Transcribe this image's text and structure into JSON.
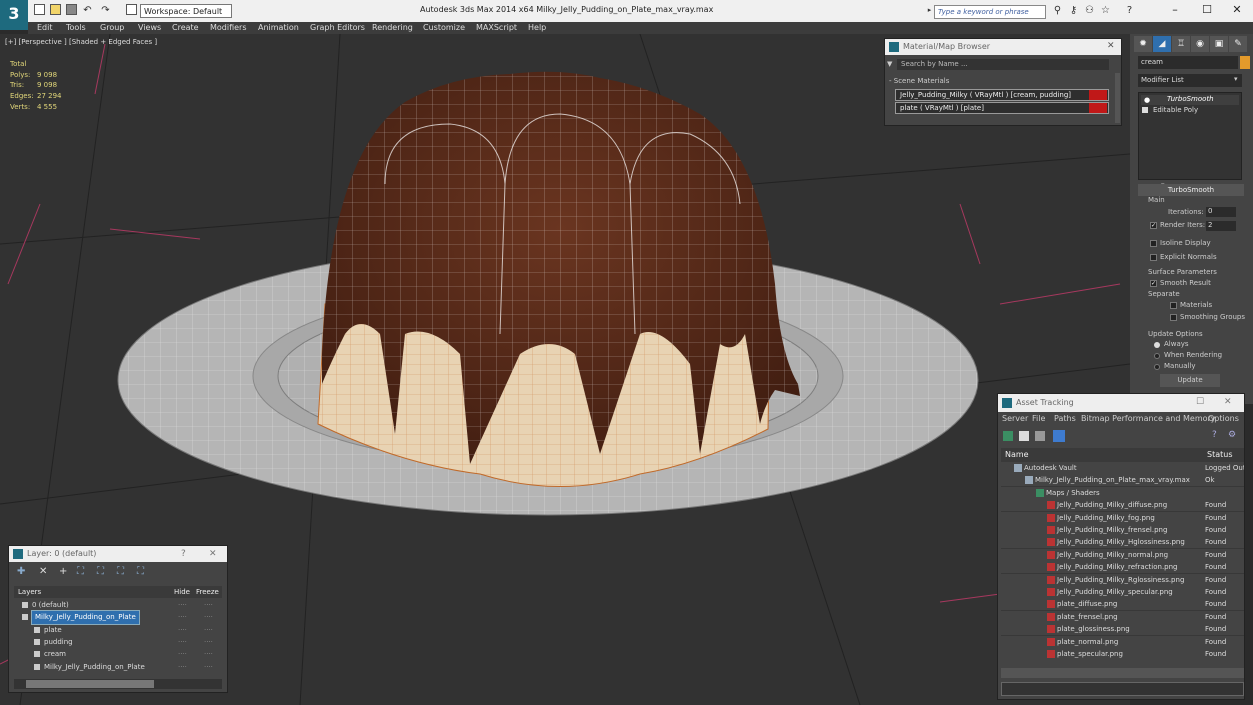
{
  "titlebar": {
    "logo": "3",
    "workspace_label": "Workspace: Default",
    "app_title": "Autodesk 3ds Max  2014 x64      Milky_Jelly_Pudding_on_Plate_max_vray.max",
    "search_placeholder": "Type a keyword or phrase",
    "minimize": "–",
    "maximize": "☐",
    "close": "✕"
  },
  "menu": [
    "Edit",
    "Tools",
    "Group",
    "Views",
    "Create",
    "Modifiers",
    "Animation",
    "Graph Editors",
    "Rendering",
    "Customize",
    "MAXScript",
    "Help"
  ],
  "viewport": {
    "label": "[+] [Perspective ] [Shaded + Edged Faces ]",
    "stats": {
      "total": "Total",
      "polys_label": "Polys:",
      "polys": "9 098",
      "tris_label": "Tris:",
      "tris": "9 098",
      "edges_label": "Edges:",
      "edges": "27 294",
      "verts_label": "Verts:",
      "verts": "4 555"
    }
  },
  "material_browser": {
    "title": "Material/Map Browser",
    "search_placeholder": "Search by Name ...",
    "section": "- Scene Materials",
    "items": [
      "Jelly_Pudding_Milky  ( VRayMtl )  [cream, pudding]",
      "plate  ( VRayMtl )  [plate]"
    ]
  },
  "command_panel": {
    "object_name": "cream",
    "modifier_list": "Modifier List",
    "stack": [
      "TurboSmooth",
      "Editable Poly"
    ],
    "rollout": "TurboSmooth",
    "main": "Main",
    "iterations_label": "Iterations:",
    "iterations": "0",
    "render_iters_label": "Render Iters:",
    "render_iters": "2",
    "isoline": "Isoline Display",
    "explicit": "Explicit Normals",
    "surface_params": "Surface Parameters",
    "smooth_result": "Smooth Result",
    "separate": "Separate",
    "materials": "Materials",
    "smoothing_groups": "Smoothing Groups",
    "update_options": "Update Options",
    "always": "Always",
    "when_rendering": "When Rendering",
    "manually": "Manually",
    "update": "Update"
  },
  "asset_tracking": {
    "title": "Asset Tracking",
    "menu": [
      "Server",
      "File",
      "Paths",
      "Bitmap Performance and Memory",
      "Options"
    ],
    "col_name": "Name",
    "col_status": "Status",
    "rows": [
      {
        "name": "Autodesk Vault",
        "status": "Logged Out",
        "indent": 1
      },
      {
        "name": "Milky_Jelly_Pudding_on_Plate_max_vray.max",
        "status": "Ok",
        "indent": 2
      },
      {
        "name": "Maps / Shaders",
        "status": "",
        "indent": 3
      },
      {
        "name": "Jelly_Pudding_Milky_diffuse.png",
        "status": "Found",
        "indent": 4
      },
      {
        "name": "Jelly_Pudding_Milky_fog.png",
        "status": "Found",
        "indent": 4
      },
      {
        "name": "Jelly_Pudding_Milky_frensel.png",
        "status": "Found",
        "indent": 4
      },
      {
        "name": "Jelly_Pudding_Milky_Hglossiness.png",
        "status": "Found",
        "indent": 4
      },
      {
        "name": "Jelly_Pudding_Milky_normal.png",
        "status": "Found",
        "indent": 4
      },
      {
        "name": "Jelly_Pudding_Milky_refraction.png",
        "status": "Found",
        "indent": 4
      },
      {
        "name": "Jelly_Pudding_Milky_Rglossiness.png",
        "status": "Found",
        "indent": 4
      },
      {
        "name": "Jelly_Pudding_Milky_specular.png",
        "status": "Found",
        "indent": 4
      },
      {
        "name": "plate_diffuse.png",
        "status": "Found",
        "indent": 4
      },
      {
        "name": "plate_frensel.png",
        "status": "Found",
        "indent": 4
      },
      {
        "name": "plate_glossiness.png",
        "status": "Found",
        "indent": 4
      },
      {
        "name": "plate_normal.png",
        "status": "Found",
        "indent": 4
      },
      {
        "name": "plate_specular.png",
        "status": "Found",
        "indent": 4
      }
    ]
  },
  "layer_panel": {
    "title": "Layer: 0 (default)",
    "help": "?",
    "col_layers": "Layers",
    "col_hide": "Hide",
    "col_freeze": "Freeze",
    "rows": [
      {
        "name": "0 (default)",
        "indent": 0,
        "selected": false
      },
      {
        "name": "Milky_Jelly_Pudding_on_Plate",
        "indent": 0,
        "selected": true
      },
      {
        "name": "plate",
        "indent": 1,
        "selected": false
      },
      {
        "name": "pudding",
        "indent": 1,
        "selected": false
      },
      {
        "name": "cream",
        "indent": 1,
        "selected": false
      },
      {
        "name": "Milky_Jelly_Pudding_on_Plate",
        "indent": 1,
        "selected": false
      }
    ]
  }
}
